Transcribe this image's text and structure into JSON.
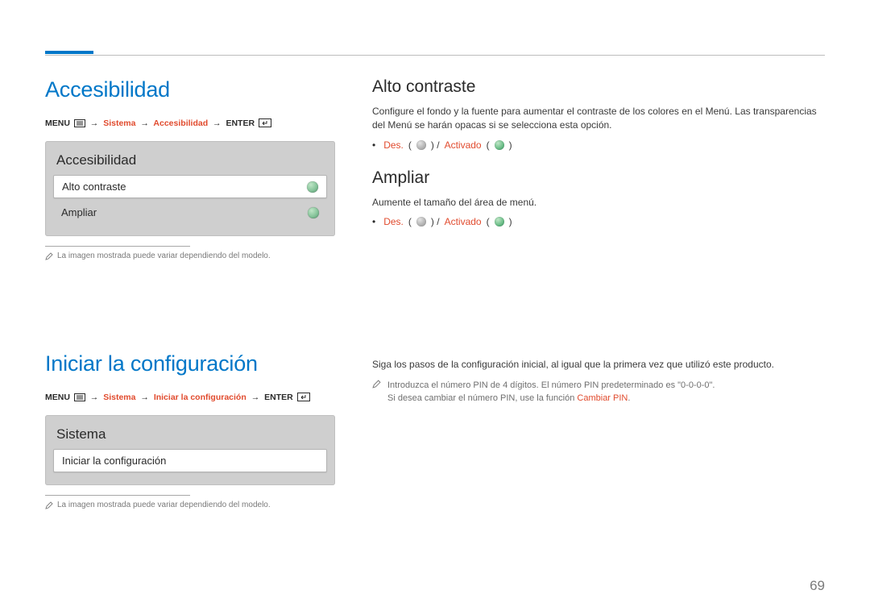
{
  "page_number": "69",
  "left": {
    "accessibility": {
      "title": "Accesibilidad",
      "breadcrumb": {
        "menu": "MENU",
        "sistema": "Sistema",
        "accesibilidad": "Accesibilidad",
        "enter": "ENTER"
      },
      "panel": {
        "title": "Accesibilidad",
        "rows": [
          {
            "label": "Alto contraste"
          },
          {
            "label": "Ampliar"
          }
        ]
      },
      "footnote": "La imagen mostrada puede variar dependiendo del modelo."
    },
    "iniciar": {
      "title": "Iniciar la configuración",
      "breadcrumb": {
        "menu": "MENU",
        "sistema": "Sistema",
        "iniciar": "Iniciar la configuración",
        "enter": "ENTER"
      },
      "panel": {
        "title": "Sistema",
        "rows": [
          {
            "label": "Iniciar la configuración"
          }
        ]
      },
      "footnote": "La imagen mostrada puede variar dependiendo del modelo."
    }
  },
  "right": {
    "alto_contraste": {
      "title": "Alto contraste",
      "desc": "Configure el fondo y la fuente para aumentar el contraste de los colores en el Menú. Las transparencias del Menú se harán opacas si se selecciona esta opción.",
      "off": "Des.",
      "on": "Activado"
    },
    "ampliar": {
      "title": "Ampliar",
      "desc": "Aumente el tamaño del área de menú.",
      "off": "Des.",
      "on": "Activado"
    },
    "iniciar_desc": "Siga los pasos de la configuración inicial, al igual que la primera vez que utilizó este producto.",
    "iniciar_note_line1": "Introduzca el número PIN de 4 dígitos. El número PIN predeterminado es \"0-0-0-0\".",
    "iniciar_note_line2_a": "Si desea cambiar el número PIN, use la función ",
    "iniciar_note_line2_b": "Cambiar PIN",
    "iniciar_note_line2_c": "."
  }
}
